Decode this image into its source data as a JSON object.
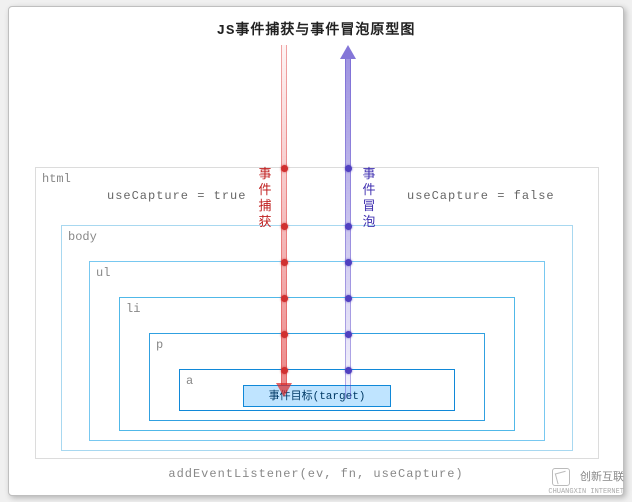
{
  "title": "JS事件捕获与事件冒泡原型图",
  "labels": {
    "html": "html",
    "body": "body",
    "ul": "ul",
    "li": "li",
    "p": "p",
    "a": "a"
  },
  "capture_true": "useCapture = true",
  "capture_false": "useCapture = false",
  "capture_label": {
    "c1": "事",
    "c2": "件",
    "c3": "捕",
    "c4": "获"
  },
  "bubble_label": {
    "c1": "事",
    "c2": "件",
    "c3": "冒",
    "c4": "泡"
  },
  "target_label": "事件目标(target)",
  "footer": "addEventListener(ev, fn, useCapture)",
  "watermark_line1": "创新互联",
  "watermark_line2": "CHUANGXIN INTERNET",
  "chart_data": {
    "type": "diagram",
    "title": "JS事件捕获与事件冒泡原型图",
    "description": "Nested DOM boxes html > body > ul > li > p > a with target at center. Red downward arrow on left = capture phase (useCapture=true). Purple upward arrow on right = bubble phase (useCapture=false).",
    "nesting": [
      "html",
      "body",
      "ul",
      "li",
      "p",
      "a",
      "target"
    ],
    "phases": [
      {
        "name": "事件捕获",
        "direction": "down",
        "color": "#d03030",
        "side": "left",
        "useCapture": true
      },
      {
        "name": "事件冒泡",
        "direction": "up",
        "color": "#5040c0",
        "side": "right",
        "useCapture": false
      }
    ],
    "api": "addEventListener(ev, fn, useCapture)"
  }
}
